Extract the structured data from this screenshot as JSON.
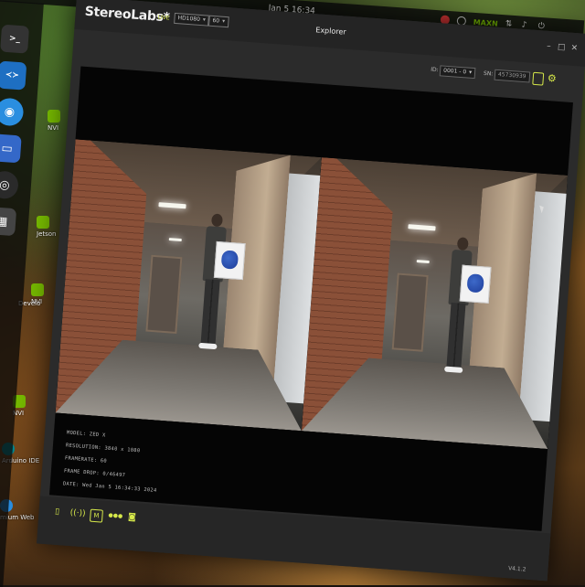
{
  "system": {
    "clock": "Jan 5  16:34",
    "tray_brand": "MAXN"
  },
  "dock": {
    "items": [
      {
        "name": "terminal-icon",
        "glyph": ">_",
        "color": "#333333"
      },
      {
        "name": "vscode-icon",
        "glyph": "≺≻",
        "color": "#1e6fc2"
      },
      {
        "name": "chromium-icon",
        "glyph": "◉",
        "color": "#2a8ee0"
      },
      {
        "name": "screenshot-icon",
        "glyph": "▭",
        "color": "#3468c8"
      },
      {
        "name": "obs-icon",
        "glyph": "◎",
        "color": "#2a2a2a"
      },
      {
        "name": "app-icon",
        "glyph": "▦",
        "color": "#444444"
      }
    ]
  },
  "desktop_icons": [
    {
      "label": "NVI",
      "color": "#76b900"
    },
    {
      "label": "Jetson",
      "color": "#76b900"
    },
    {
      "label": "NVI",
      "color": "#76b900"
    },
    {
      "label": "Develo",
      "color": "#76b900"
    },
    {
      "label": "NVI",
      "color": "#76b900"
    },
    {
      "label": "Arduino IDE",
      "color": "#00878f"
    },
    {
      "label": "mium Web",
      "color": "#2a8ee0"
    }
  ],
  "app": {
    "brand": "StereoLabs*",
    "live_label": "LIVE",
    "resolution_select": "HD1080",
    "fps_select": "60",
    "title": "Explorer",
    "id_label": "ID:",
    "id_value": "0001 - 0",
    "sn_label": "SN:",
    "sn_value": "45730939",
    "info": {
      "model": "MODEL: ZED X",
      "resolution": "RESOLUTION: 3840 x 1080",
      "framerate": "FRAMERATE: 60",
      "frame_drop": "FRAME DROP: 0/46497",
      "date": "DATE: Wed Jan 5 16:34:33 2024"
    },
    "version": "V4.1.2"
  },
  "colors": {
    "accent": "#d6e84a",
    "nvidia": "#76b900",
    "window_bg": "#2b2b2b"
  }
}
